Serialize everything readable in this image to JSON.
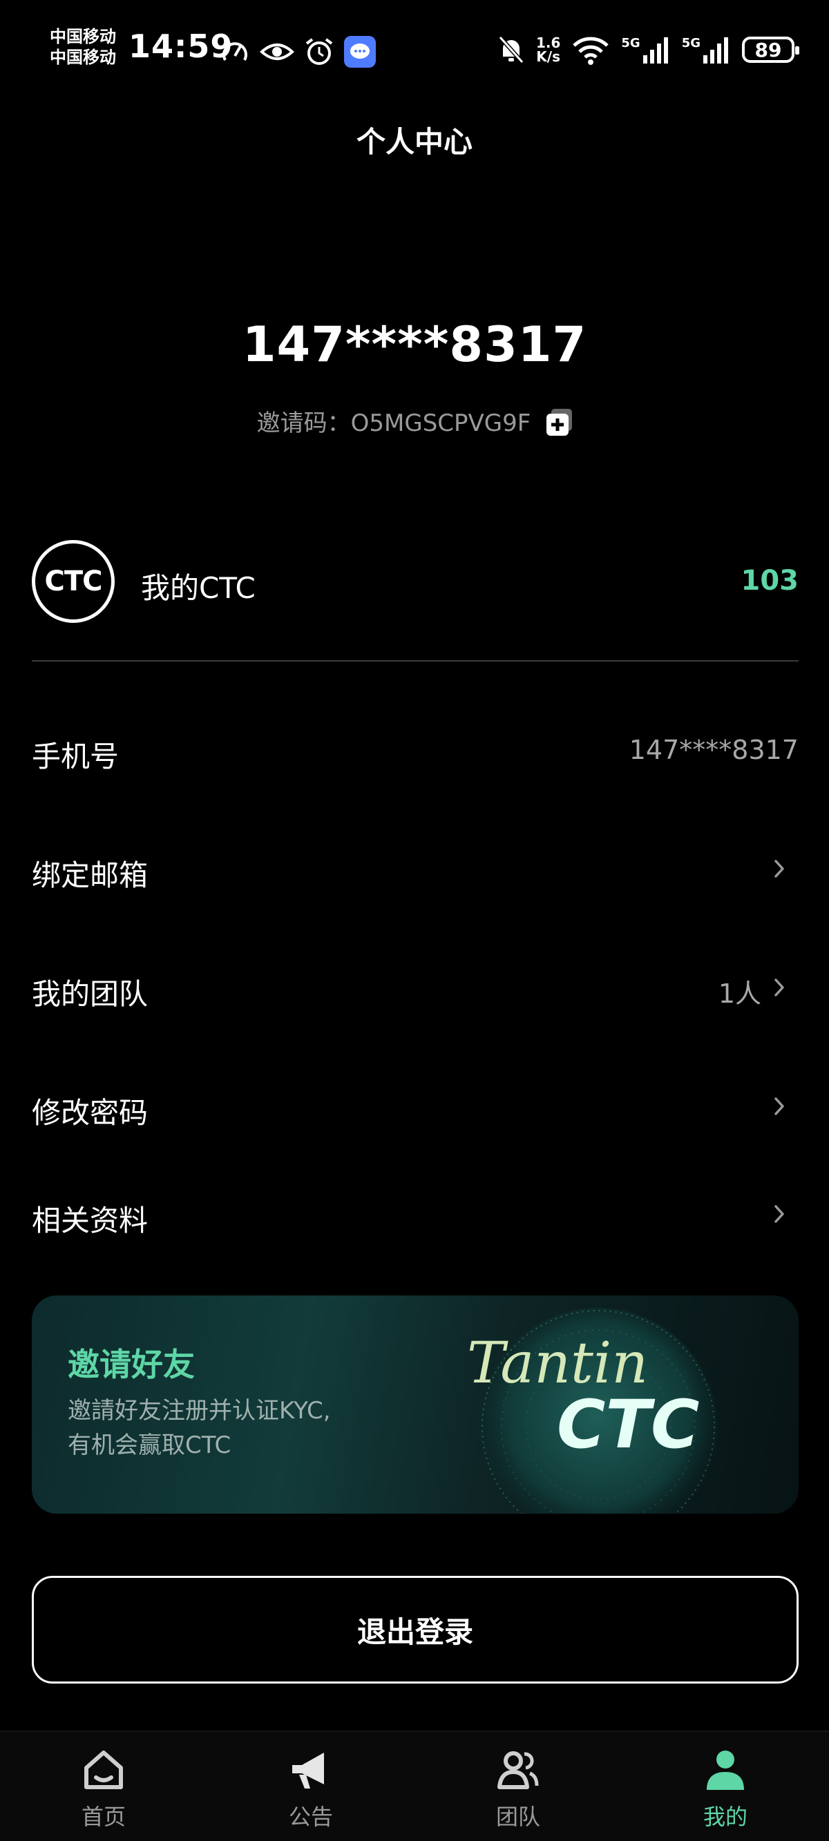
{
  "status_bar": {
    "carrier_1": "中国移动",
    "carrier_2": "中国移动",
    "time": "14:59",
    "net_speed_value": "1.6",
    "net_speed_unit": "K/s",
    "signal_1": "5G",
    "signal_2": "5G",
    "battery": "89"
  },
  "page_title": "个人中心",
  "profile": {
    "user_id": "147****8317",
    "invite_label": "邀请码：",
    "invite_code": "O5MGSCPVG9F"
  },
  "ctc": {
    "logo_text": "CTC",
    "label": "我的CTC",
    "value": "103"
  },
  "menu": [
    {
      "label": "手机号",
      "value": "147****8317"
    },
    {
      "label": "绑定邮箱",
      "value": ""
    },
    {
      "label": "我的团队",
      "value": "1人"
    },
    {
      "label": "修改密码",
      "value": ""
    },
    {
      "label": "相关资料",
      "value": ""
    }
  ],
  "banner": {
    "title": "邀请好友",
    "desc_line1": "邀請好友注册并认证KYC,",
    "desc_line2": "有机会赢取CTC",
    "art_text_1": "Tantin",
    "art_text_2": "CTC"
  },
  "logout_label": "退出登录",
  "tabs": [
    {
      "label": "首页",
      "icon": "home-icon"
    },
    {
      "label": "公告",
      "icon": "megaphone-icon"
    },
    {
      "label": "团队",
      "icon": "team-icon"
    },
    {
      "label": "我的",
      "icon": "person-icon",
      "active": true
    }
  ],
  "colors": {
    "accent": "#5ed6a6",
    "background": "#000000"
  }
}
